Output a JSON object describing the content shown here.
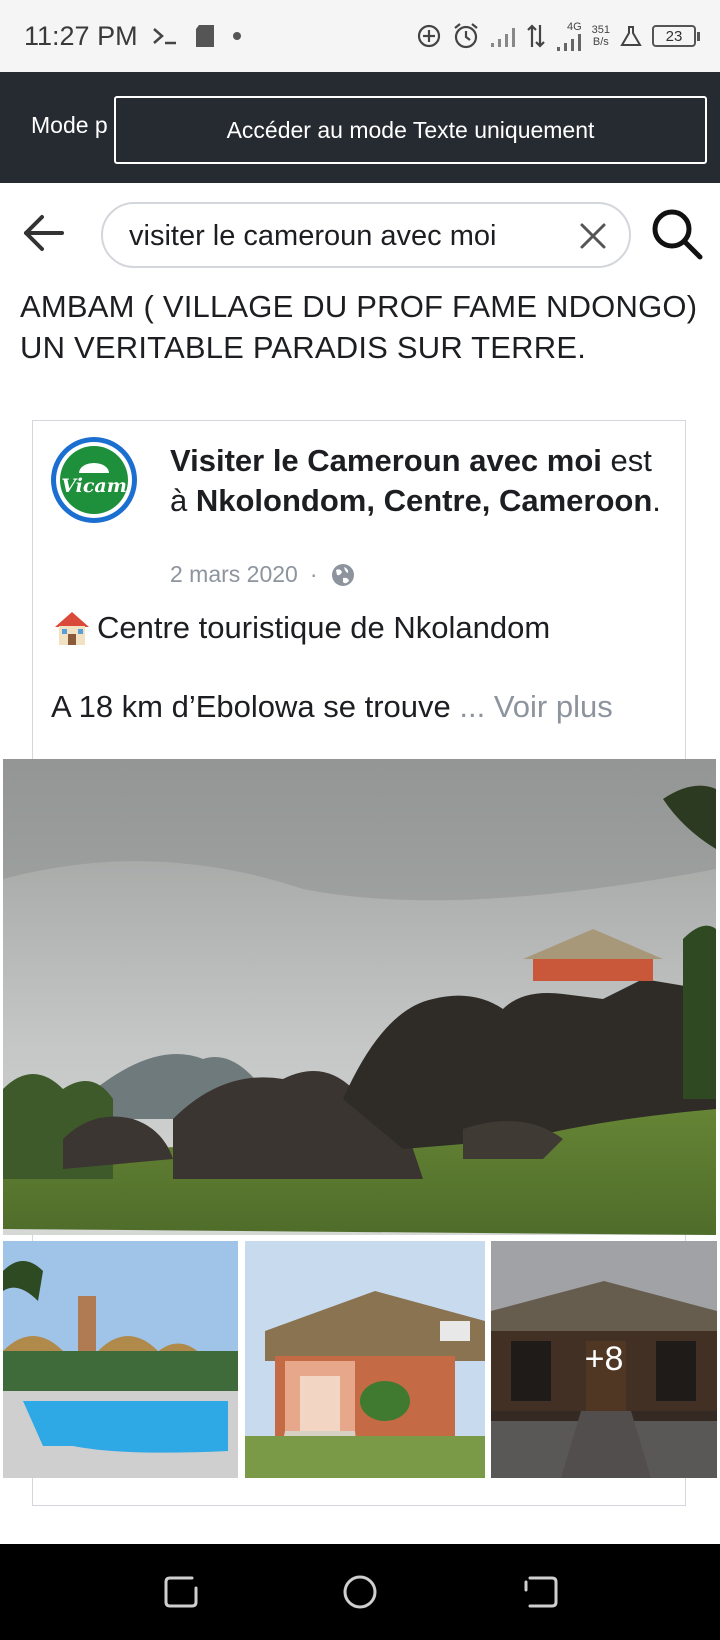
{
  "status_bar": {
    "time": "11:27 PM",
    "network_type": "4G",
    "speed_value": "351",
    "speed_unit": "B/s",
    "battery": "23"
  },
  "banner": {
    "mode_text": "Mode p",
    "button_label": "Accéder au mode Texte uniquement"
  },
  "search": {
    "query": "visiter le cameroun avec moi"
  },
  "post": {
    "text": "AMBAM ( VILLAGE DU PROF FAME NDONGO) UN VERITABLE PARADIS SUR TERRE."
  },
  "shared": {
    "page_name": "Visiter le Cameroun avec moi",
    "at_text": " est à ",
    "location": "Nkolondom, Centre, Cameroon",
    "period": ".",
    "date": "2 mars 2020",
    "separator": "·",
    "line1": "Centre touristique de Nkolandom",
    "line2": "A 18 km d’Ebolowa se trouve ",
    "see_more": "... Voir plus",
    "avatar_text": "Vicam",
    "more_photos": "+8"
  },
  "colors": {
    "banner_bg": "#262b31",
    "accent_blue": "#1b6fd0",
    "muted_text": "#8d949e"
  }
}
